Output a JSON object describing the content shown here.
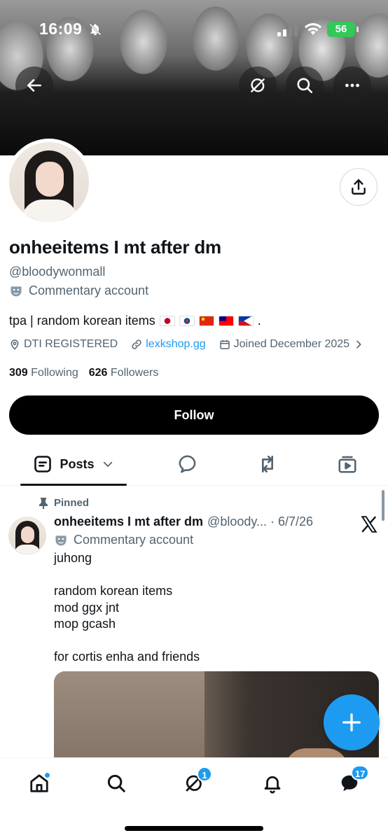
{
  "status_bar": {
    "time": "16:09",
    "battery": "56"
  },
  "header": {
    "back_icon": "arrow-left-icon",
    "grok_icon": "grok-icon",
    "search_icon": "search-icon",
    "more_icon": "more-icon"
  },
  "profile": {
    "name": "onheeitems I mt after dm",
    "handle": "@bloodywonmall",
    "label": "Commentary account",
    "bio_text": "tpa | random korean items",
    "bio_end": ".",
    "location": "DTI REGISTERED",
    "website": "lexkshop.gg",
    "joined": "Joined December 2025",
    "following_count": "309",
    "following_label": "Following",
    "followers_count": "626",
    "followers_label": "Followers",
    "follow_button": "Follow"
  },
  "tabs": {
    "posts": "Posts"
  },
  "pinned_post": {
    "pinned_label": "Pinned",
    "author_name": "onheeitems I mt after dm",
    "author_handle_date": "@bloody... · 6/7/26",
    "author_label": "Commentary account",
    "lines": [
      "juhong",
      "",
      "random korean items",
      "mod ggx jnt",
      "mop gcash",
      "",
      "for cortis enha and friends"
    ]
  },
  "bottom_nav": {
    "grok_badge": "1",
    "messages_badge": "17"
  },
  "colors": {
    "accent": "#1d9bf0",
    "text_primary": "#0f1419",
    "text_secondary": "#536471",
    "follow_button_bg": "#000000",
    "battery_green": "#34c759"
  }
}
